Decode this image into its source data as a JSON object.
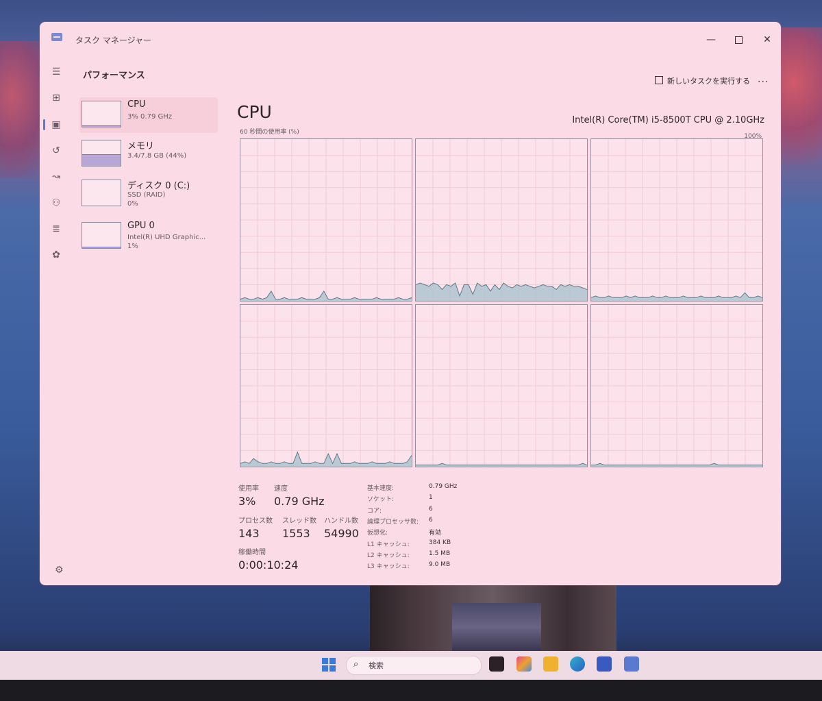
{
  "window": {
    "title": "タスク マネージャー"
  },
  "header": {
    "title": "パフォーマンス",
    "new_task": "新しいタスクを実行する",
    "more": "..."
  },
  "nav_icons": [
    "hamburger-icon",
    "processes-icon",
    "performance-icon",
    "history-icon",
    "startup-icon",
    "users-icon",
    "details-icon",
    "services-icon"
  ],
  "resources": [
    {
      "name": "CPU",
      "sub1": "3%  0.79 GHz",
      "sub2": "",
      "fill": 0.03
    },
    {
      "name": "メモリ",
      "sub1": "3.4/7.8 GB (44%)",
      "sub2": "",
      "fill": 0.44
    },
    {
      "name": "ディスク 0 (C:)",
      "sub1": "SSD (RAID)",
      "sub2": "0%",
      "fill": 0.0
    },
    {
      "name": "GPU 0",
      "sub1": "Intel(R) UHD Graphic...",
      "sub2": "1%",
      "fill": 0.01
    }
  ],
  "main": {
    "title": "CPU",
    "model": "Intel(R) Core(TM) i5-8500T CPU @ 2.10GHz",
    "graph_label": "60 秒間の使用率 (%)",
    "graph_max": "100%"
  },
  "stats": {
    "usage_label": "使用率",
    "usage_value": "3%",
    "speed_label": "速度",
    "speed_value": "0.79 GHz",
    "processes_label": "プロセス数",
    "processes_value": "143",
    "threads_label": "スレッド数",
    "threads_value": "1553",
    "handles_label": "ハンドル数",
    "handles_value": "54990",
    "uptime_label": "稼働時間",
    "uptime_value": "0:00:10:24"
  },
  "specs": [
    {
      "label": "基本速度:",
      "value": "0.79 GHz"
    },
    {
      "label": "ソケット:",
      "value": "1"
    },
    {
      "label": "コア:",
      "value": "6"
    },
    {
      "label": "論理プロセッサ数:",
      "value": "6"
    },
    {
      "label": "仮想化:",
      "value": "有効"
    },
    {
      "label": "L1 キャッシュ:",
      "value": "384 KB"
    },
    {
      "label": "L2 キャッシュ:",
      "value": "1.5 MB"
    },
    {
      "label": "L3 キャッシュ:",
      "value": "9.0 MB"
    }
  ],
  "taskbar": {
    "search_label": "検索"
  },
  "chart_data": {
    "type": "area",
    "ylim": [
      0,
      100
    ],
    "series": [
      {
        "values": [
          1,
          2,
          1,
          1,
          2,
          1,
          2,
          6,
          1,
          1,
          2,
          1,
          1,
          1,
          2,
          1,
          1,
          1,
          2,
          6,
          1,
          1,
          2,
          1,
          1,
          1,
          2,
          1,
          1,
          1,
          1,
          2,
          1,
          1,
          1,
          1,
          2,
          1,
          1,
          2
        ]
      },
      {
        "values": [
          10,
          11,
          10,
          9,
          11,
          10,
          7,
          10,
          9,
          11,
          3,
          10,
          10,
          4,
          11,
          9,
          10,
          6,
          10,
          7,
          11,
          9,
          8,
          10,
          9,
          10,
          9,
          8,
          9,
          10,
          9,
          9,
          7,
          10,
          9,
          10,
          9,
          9,
          8,
          7
        ]
      },
      {
        "values": [
          2,
          3,
          2,
          2,
          3,
          2,
          2,
          2,
          3,
          2,
          3,
          2,
          2,
          2,
          3,
          2,
          2,
          3,
          2,
          2,
          2,
          3,
          2,
          2,
          2,
          3,
          2,
          2,
          2,
          3,
          2,
          2,
          2,
          3,
          2,
          5,
          2,
          2,
          3,
          2
        ]
      },
      {
        "values": [
          2,
          3,
          2,
          5,
          3,
          2,
          2,
          3,
          2,
          2,
          3,
          2,
          2,
          9,
          2,
          2,
          2,
          3,
          2,
          2,
          8,
          2,
          8,
          2,
          2,
          2,
          3,
          2,
          2,
          2,
          3,
          2,
          2,
          2,
          3,
          2,
          2,
          2,
          3,
          7
        ]
      },
      {
        "values": [
          1,
          1,
          1,
          1,
          1,
          1,
          2,
          1,
          1,
          1,
          1,
          1,
          1,
          1,
          1,
          1,
          1,
          1,
          1,
          1,
          1,
          1,
          1,
          1,
          1,
          1,
          1,
          1,
          1,
          1,
          1,
          1,
          1,
          1,
          1,
          1,
          1,
          1,
          2,
          1
        ]
      },
      {
        "values": [
          1,
          1,
          2,
          1,
          1,
          1,
          1,
          1,
          1,
          1,
          1,
          1,
          1,
          1,
          1,
          1,
          1,
          1,
          1,
          1,
          1,
          1,
          1,
          1,
          1,
          1,
          1,
          1,
          2,
          1,
          1,
          1,
          1,
          1,
          1,
          1,
          1,
          1,
          1,
          1
        ]
      }
    ]
  }
}
